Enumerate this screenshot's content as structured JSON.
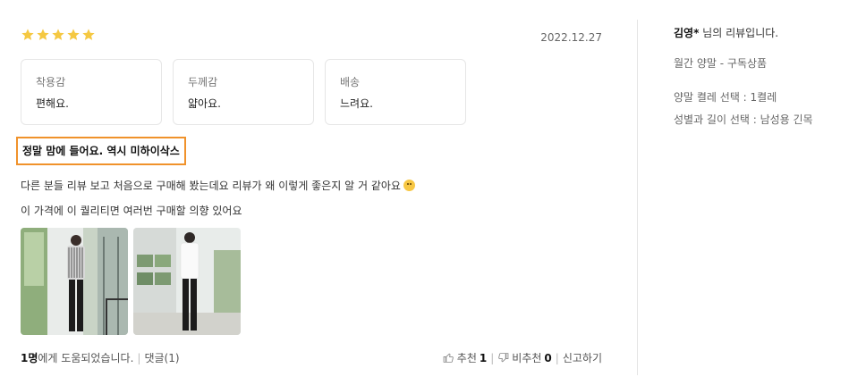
{
  "review": {
    "rating": 5,
    "date": "2022.12.27",
    "attributes": [
      {
        "label": "착용감",
        "value": "편해요."
      },
      {
        "label": "두께감",
        "value": "얇아요."
      },
      {
        "label": "배송",
        "value": "느려요."
      }
    ],
    "headline": "정말 맘에 들어요. 역시 미하이삭스",
    "body_line1": "다른 분들 리뷰 보고 처음으로 구매해 봤는데요 리뷰가 왜 이렇게 좋은지 알 거 같아요",
    "body_line2": "이 가격에 이 퀄리티면 여러번 구매할 의향 있어요",
    "photos": [
      "review-photo-1",
      "review-photo-2"
    ]
  },
  "footer": {
    "helpful_count": "1명",
    "helpful_suffix": "에게 도움되었습니다.",
    "comments_label": "댓글(1)",
    "recommend_label": "추천",
    "recommend_count": "1",
    "not_recommend_label": "비추천",
    "not_recommend_count": "0",
    "report_label": "신고하기"
  },
  "sidebar": {
    "reviewer_name": "김영*",
    "reviewer_suffix": " 님의 리뷰입니다.",
    "product": "월간 양말 - 구독상품",
    "options": [
      "양말 켤레 선택 : 1켤레",
      "성별과 길이 선택 : 남성용 긴목"
    ]
  },
  "colors": {
    "star": "#f5c842",
    "headline_border": "#f0922b",
    "divider": "#e5e5e5"
  },
  "icons": [
    "star-icon",
    "smile-emoji-icon",
    "thumbs-up-icon",
    "thumbs-down-icon"
  ]
}
